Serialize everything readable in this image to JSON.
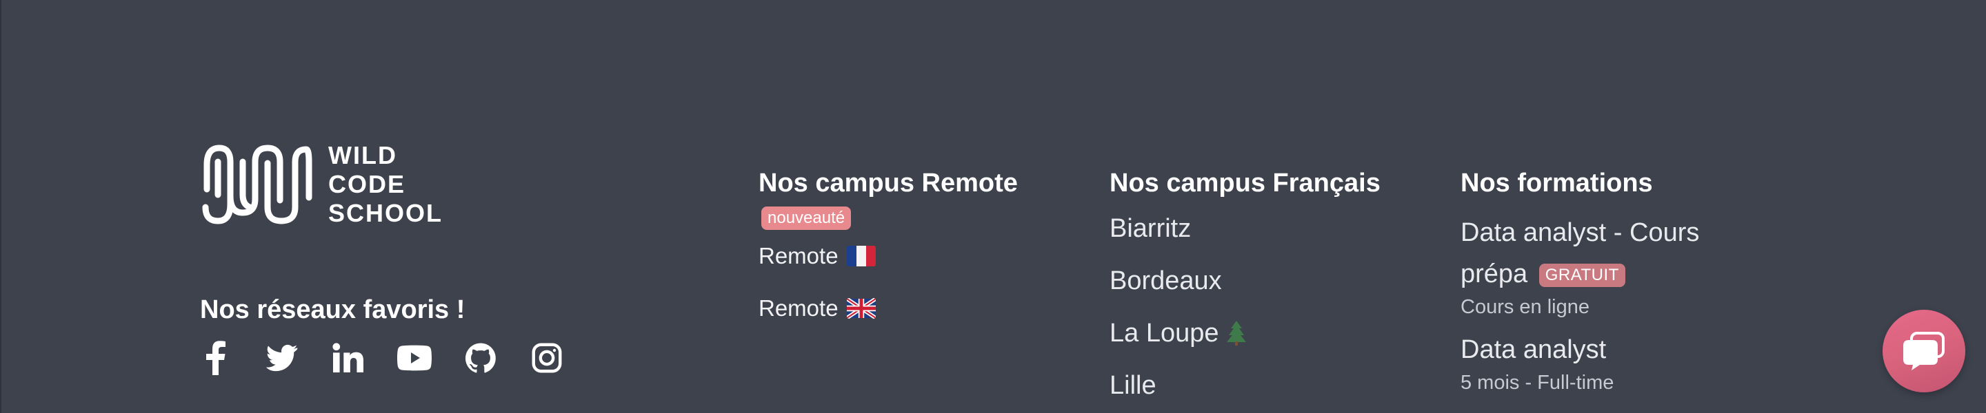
{
  "brand": {
    "logo_lines": [
      "WILD",
      "CODE",
      "SCHOOL"
    ]
  },
  "social": {
    "title": "Nos réseaux favoris !",
    "icons": [
      "facebook-icon",
      "twitter-icon",
      "linkedin-icon",
      "youtube-icon",
      "github-icon",
      "instagram-icon"
    ]
  },
  "remote": {
    "title": "Nos campus Remote",
    "badge": "nouveauté",
    "items": [
      {
        "label": "Remote",
        "flag": "france-flag-icon"
      },
      {
        "label": "Remote",
        "flag": "uk-flag-icon"
      }
    ]
  },
  "france": {
    "title": "Nos campus Français",
    "items": [
      "Biarritz",
      "Bordeaux",
      "La Loupe",
      "Lille"
    ],
    "la_loupe_icon": "pine-tree-icon"
  },
  "formations": {
    "title": "Nos formations",
    "items": [
      {
        "title_line1": "Data analyst - Cours",
        "title_line2": "prépa",
        "badge": "GRATUIT",
        "subtitle": "Cours en ligne"
      },
      {
        "title_line1": "Data analyst",
        "subtitle": "5 mois - Full-time"
      }
    ]
  },
  "chat": {
    "icon": "chat-bubble-icon"
  },
  "colors": {
    "background": "#3d424d",
    "badge": "#e8898d",
    "chat_button": "#e56a8a"
  }
}
